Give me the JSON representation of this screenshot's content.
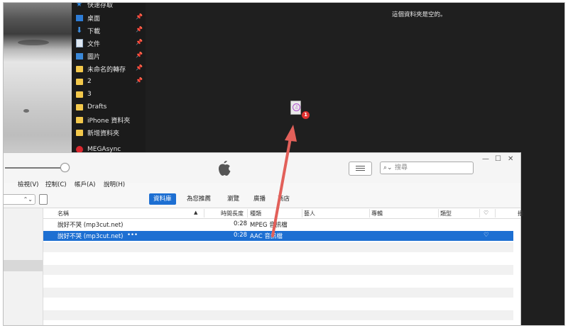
{
  "explorer": {
    "nav_items": [
      {
        "label": "快速存取",
        "icon": "star-icon",
        "pinned": false
      },
      {
        "label": "桌面",
        "icon": "desktop-icon",
        "pinned": true
      },
      {
        "label": "下載",
        "icon": "download-arrow-icon",
        "pinned": true
      },
      {
        "label": "文件",
        "icon": "document-icon",
        "pinned": true
      },
      {
        "label": "圖片",
        "icon": "pictures-icon",
        "pinned": true
      },
      {
        "label": "未命名的轉存",
        "icon": "folder-icon",
        "pinned": true
      },
      {
        "label": "2",
        "icon": "folder-icon",
        "pinned": true
      },
      {
        "label": "3",
        "icon": "folder-icon",
        "pinned": false
      },
      {
        "label": "Drafts",
        "icon": "folder-icon",
        "pinned": false
      },
      {
        "label": "iPhone 資料夾",
        "icon": "folder-icon",
        "pinned": false
      },
      {
        "label": "新增資料夾",
        "icon": "folder-icon",
        "pinned": false
      },
      {
        "label": "MEGAsync",
        "icon": "mega-icon",
        "pinned": false
      }
    ],
    "empty_message": "這個資料夾是空的。",
    "drag_badge_count": "1"
  },
  "itunes": {
    "search_placeholder": "搜尋",
    "menu": [
      "檢視(V)",
      "控制(C)",
      "帳戶(A)",
      "說明(H)"
    ],
    "tabs": [
      {
        "label": "資料庫",
        "active": true
      },
      {
        "label": "為您推薦",
        "active": false
      },
      {
        "label": "瀏覽",
        "active": false
      },
      {
        "label": "廣播",
        "active": false
      },
      {
        "label": "商店",
        "active": false
      }
    ],
    "columns": {
      "name": "名稱",
      "duration": "時間長度",
      "kind": "種類",
      "artist": "藝人",
      "album": "專輯",
      "genre": "類型",
      "heart": "♡",
      "extra": "播"
    },
    "rows": [
      {
        "name": "說好不哭 (mp3cut.net)",
        "duration": "0:28",
        "kind": "MPEG 音訊檔",
        "more": "",
        "heart": "",
        "selected": false
      },
      {
        "name": "說好不哭 (mp3cut.net)",
        "duration": "0:28",
        "kind": "AAC 音訊檔",
        "more": "•••",
        "heart": "♡",
        "selected": true
      }
    ],
    "colors": {
      "accent": "#1d6fd2",
      "arrow": "#e2605a"
    }
  }
}
